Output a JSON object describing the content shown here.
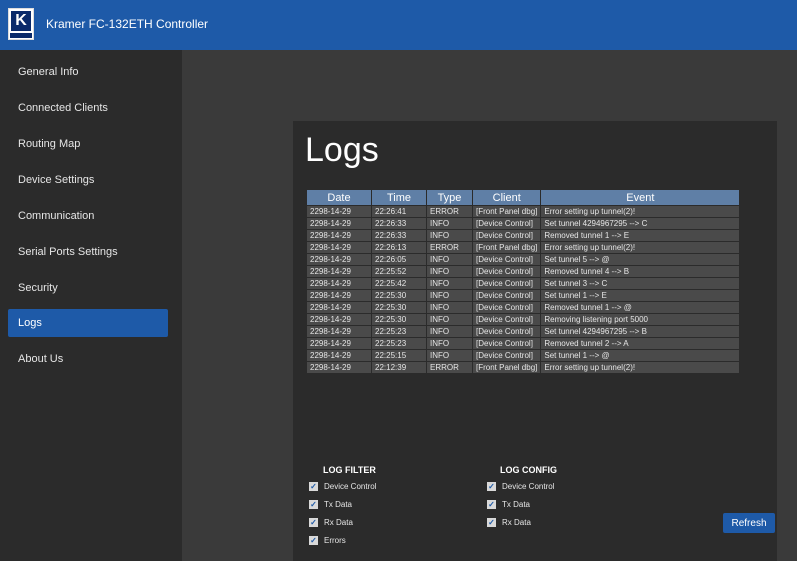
{
  "app": {
    "title": "Kramer FC-132ETH Controller",
    "logo_letter": "K"
  },
  "sidebar": {
    "items": [
      {
        "label": "General Info",
        "active": false
      },
      {
        "label": "Connected Clients",
        "active": false
      },
      {
        "label": "Routing Map",
        "active": false
      },
      {
        "label": "Device Settings",
        "active": false
      },
      {
        "label": "Communication",
        "active": false
      },
      {
        "label": "Serial Ports Settings",
        "active": false
      },
      {
        "label": "Security",
        "active": false
      },
      {
        "label": "Logs",
        "active": true
      },
      {
        "label": "About Us",
        "active": false
      }
    ]
  },
  "page": {
    "title": "Logs"
  },
  "table": {
    "headers": [
      "Date",
      "Time",
      "Type",
      "Client",
      "Event"
    ],
    "rows": [
      [
        "2298-14-29",
        "22:26:41",
        "ERROR",
        "[Front Panel dbg]",
        "Error setting up tunnel(2)!"
      ],
      [
        "2298-14-29",
        "22:26:33",
        "INFO",
        "[Device Control]",
        "Set tunnel 4294967295 --> C"
      ],
      [
        "2298-14-29",
        "22:26:33",
        "INFO",
        "[Device Control]",
        "Removed tunnel 1 --> E"
      ],
      [
        "2298-14-29",
        "22:26:13",
        "ERROR",
        "[Front Panel dbg]",
        "Error setting up tunnel(2)!"
      ],
      [
        "2298-14-29",
        "22:26:05",
        "INFO",
        "[Device Control]",
        "Set tunnel 5 --> @"
      ],
      [
        "2298-14-29",
        "22:25:52",
        "INFO",
        "[Device Control]",
        "Removed tunnel 4 --> B"
      ],
      [
        "2298-14-29",
        "22:25:42",
        "INFO",
        "[Device Control]",
        "Set tunnel 3 --> C"
      ],
      [
        "2298-14-29",
        "22:25:30",
        "INFO",
        "[Device Control]",
        "Set tunnel 1 --> E"
      ],
      [
        "2298-14-29",
        "22:25:30",
        "INFO",
        "[Device Control]",
        "Removed tunnel 1 --> @"
      ],
      [
        "2298-14-29",
        "22:25:30",
        "INFO",
        "[Device Control]",
        "Removing listening port 5000"
      ],
      [
        "2298-14-29",
        "22:25:23",
        "INFO",
        "[Device Control]",
        "Set tunnel 4294967295 --> B"
      ],
      [
        "2298-14-29",
        "22:25:23",
        "INFO",
        "[Device Control]",
        "Removed tunnel 2 --> A"
      ],
      [
        "2298-14-29",
        "22:25:15",
        "INFO",
        "[Device Control]",
        "Set tunnel 1 --> @"
      ],
      [
        "2298-14-29",
        "22:12:39",
        "ERROR",
        "[Front Panel dbg]",
        "Error setting up tunnel(2)!"
      ]
    ]
  },
  "log_filter": {
    "title": "LOG FILTER",
    "options": [
      {
        "label": "Device Control",
        "checked": true
      },
      {
        "label": "Tx Data",
        "checked": true
      },
      {
        "label": "Rx Data",
        "checked": true
      },
      {
        "label": "Errors",
        "checked": true
      }
    ]
  },
  "log_config": {
    "title": "LOG CONFIG",
    "options": [
      {
        "label": "Device Control",
        "checked": true
      },
      {
        "label": "Tx Data",
        "checked": true
      },
      {
        "label": "Rx Data",
        "checked": true
      }
    ]
  },
  "refresh_label": "Refresh",
  "colors": {
    "accent": "#1e5aa8",
    "header_cell": "#5f7fa6",
    "sidebar": "#2b2b2b",
    "background": "#3a3a3a"
  }
}
